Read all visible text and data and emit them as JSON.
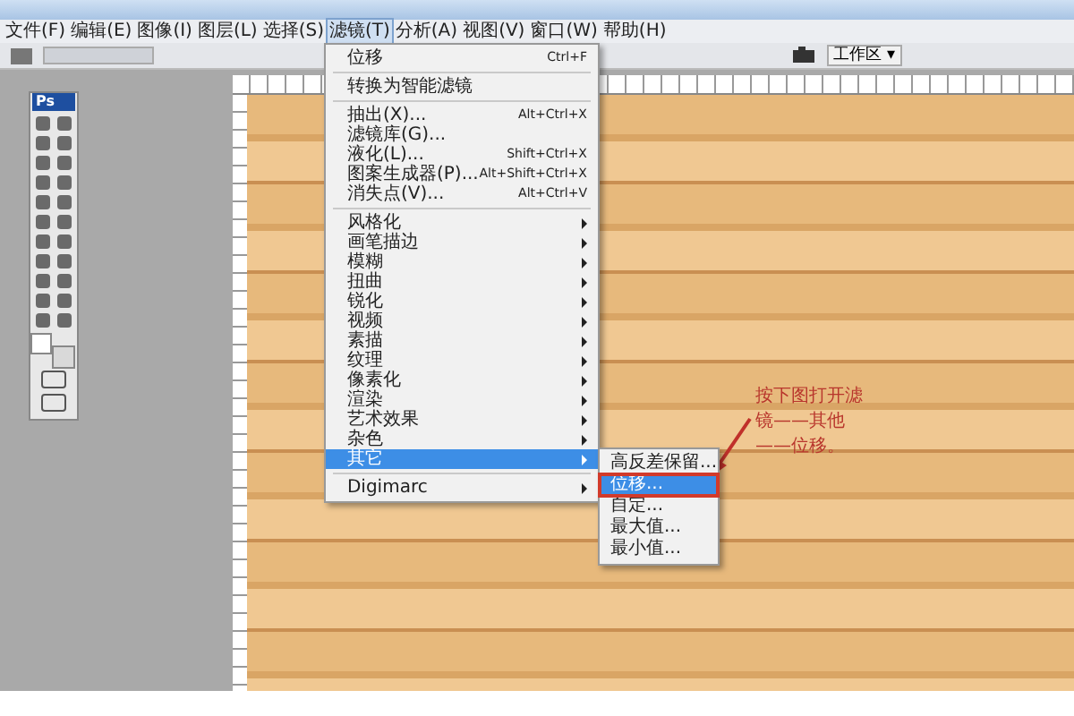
{
  "menu_bar": [
    {
      "label": "文件(F)",
      "selected": false
    },
    {
      "label": "编辑(E)",
      "selected": false
    },
    {
      "label": "图像(I)",
      "selected": false
    },
    {
      "label": "图层(L)",
      "selected": false
    },
    {
      "label": "选择(S)",
      "selected": false
    },
    {
      "label": "滤镜(T)",
      "selected": true
    },
    {
      "label": "分析(A)",
      "selected": false
    },
    {
      "label": "视图(V)",
      "selected": false
    },
    {
      "label": "窗口(W)",
      "selected": false
    },
    {
      "label": "帮助(H)",
      "selected": false
    }
  ],
  "options_bar": {
    "workspace_button": "工作区 ▾"
  },
  "toolbox": {
    "logo": "Ps"
  },
  "filter_menu": {
    "items": [
      {
        "kind": "item",
        "label": "位移",
        "shortcut": "Ctrl+F",
        "selected": false
      },
      {
        "kind": "separator"
      },
      {
        "kind": "item",
        "label": "转换为智能滤镜",
        "selected": false
      },
      {
        "kind": "separator"
      },
      {
        "kind": "item",
        "label": "抽出(X)...",
        "shortcut": "Alt+Ctrl+X",
        "selected": false
      },
      {
        "kind": "item",
        "label": "滤镜库(G)...",
        "selected": false
      },
      {
        "kind": "item",
        "label": "液化(L)...",
        "shortcut": "Shift+Ctrl+X",
        "selected": false
      },
      {
        "kind": "item",
        "label": "图案生成器(P)...",
        "shortcut": "Alt+Shift+Ctrl+X",
        "selected": false
      },
      {
        "kind": "item",
        "label": "消失点(V)...",
        "shortcut": "Alt+Ctrl+V",
        "selected": false
      },
      {
        "kind": "separator"
      },
      {
        "kind": "submenu",
        "label": "风格化",
        "selected": false
      },
      {
        "kind": "submenu",
        "label": "画笔描边",
        "selected": false
      },
      {
        "kind": "submenu",
        "label": "模糊",
        "selected": false
      },
      {
        "kind": "submenu",
        "label": "扭曲",
        "selected": false
      },
      {
        "kind": "submenu",
        "label": "锐化",
        "selected": false
      },
      {
        "kind": "submenu",
        "label": "视频",
        "selected": false
      },
      {
        "kind": "submenu",
        "label": "素描",
        "selected": false
      },
      {
        "kind": "submenu",
        "label": "纹理",
        "selected": false
      },
      {
        "kind": "submenu",
        "label": "像素化",
        "selected": false
      },
      {
        "kind": "submenu",
        "label": "渲染",
        "selected": false
      },
      {
        "kind": "submenu",
        "label": "艺术效果",
        "selected": false
      },
      {
        "kind": "submenu",
        "label": "杂色",
        "selected": false
      },
      {
        "kind": "submenu",
        "label": "其它",
        "selected": true
      },
      {
        "kind": "separator"
      },
      {
        "kind": "submenu",
        "label": "Digimarc",
        "selected": false
      }
    ]
  },
  "submenu": {
    "items": [
      {
        "label": "高反差保留...",
        "selected": false,
        "circled": false
      },
      {
        "label": "位移...",
        "selected": true,
        "circled": true
      },
      {
        "label": "自定...",
        "selected": false,
        "circled": false
      },
      {
        "label": "最大值...",
        "selected": false,
        "circled": false
      },
      {
        "label": "最小值...",
        "selected": false,
        "circled": false
      }
    ]
  },
  "annotation": {
    "lines": [
      "按下图打开滤",
      "镜——其他",
      "——位移。"
    ]
  }
}
